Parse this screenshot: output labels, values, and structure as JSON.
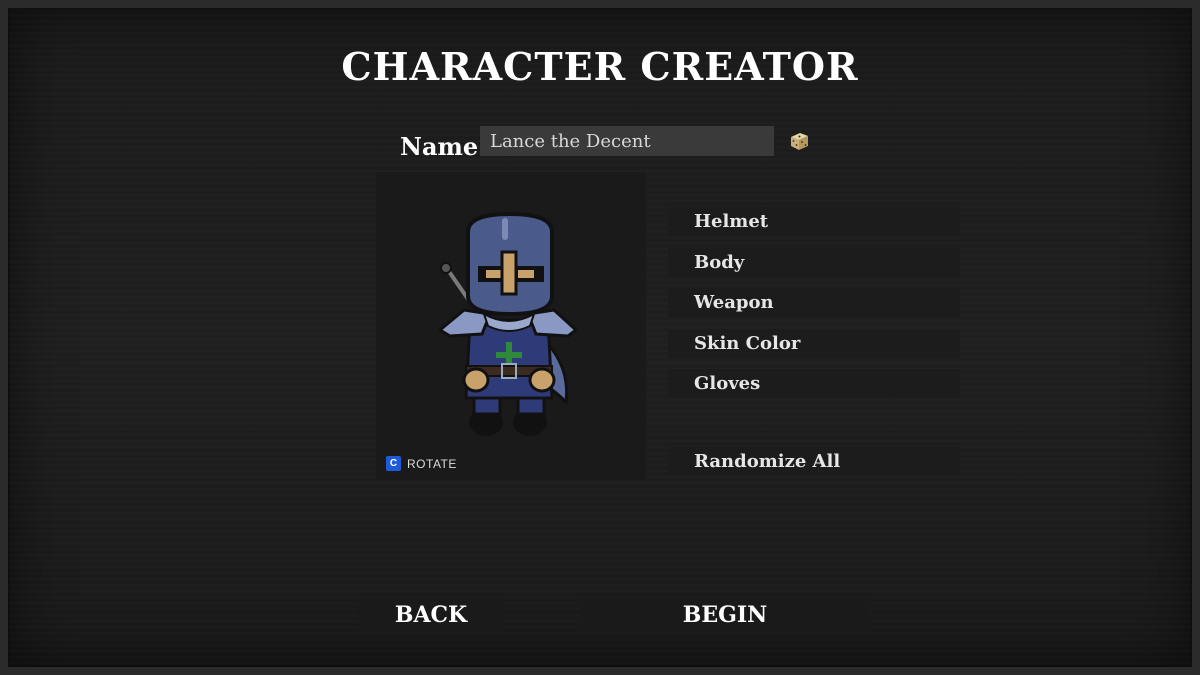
{
  "title": "CHARACTER CREATOR",
  "name_field": {
    "label": "Name:",
    "value": "Lance the Decent"
  },
  "randomize_name_icon": "dice-icon",
  "preview": {
    "rotate_key": "C",
    "rotate_label": "ROTATE"
  },
  "options": [
    {
      "label": "Helmet"
    },
    {
      "label": "Body"
    },
    {
      "label": "Weapon"
    },
    {
      "label": "Skin Color"
    },
    {
      "label": "Gloves"
    }
  ],
  "randomize_all_label": "Randomize All",
  "buttons": {
    "back_label": "BACK",
    "begin_label": "BEGIN"
  },
  "colors": {
    "background": "#1f1f1f",
    "panel": "#1c1c1c",
    "input": "#3a3a3a",
    "key_badge": "#1f5bd6",
    "armor": "#4a5a8a"
  }
}
